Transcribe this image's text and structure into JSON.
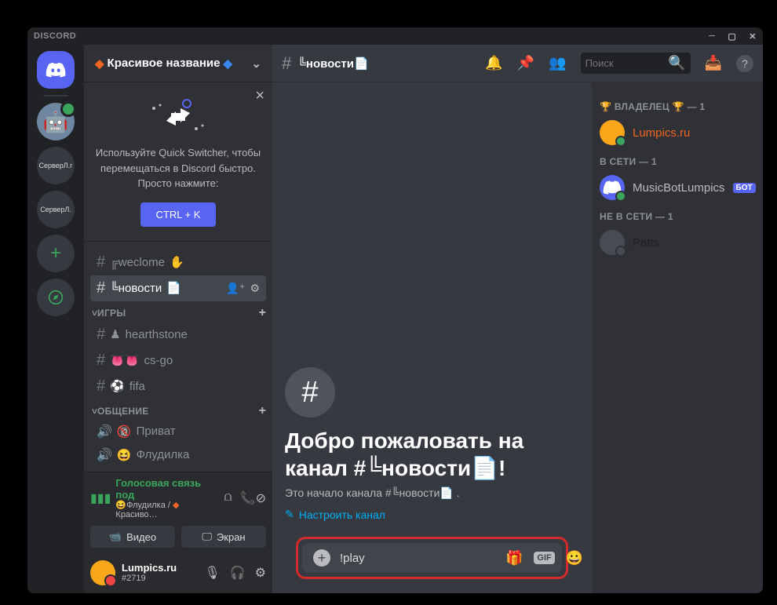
{
  "titlebar": {
    "title": "DISCORD"
  },
  "guilds": {
    "servers": [
      {
        "id": "home",
        "icon": "discord"
      },
      {
        "id": "bot",
        "label": "🤖",
        "robot": true
      },
      {
        "id": "s1",
        "label": "СерверЛ.г"
      },
      {
        "id": "s2",
        "label": "СерверЛ."
      }
    ]
  },
  "server": {
    "name_mid": "Красивое название",
    "qs_text": "Используйте Quick Switcher, чтобы перемещаться в Discord быстро. Просто нажмите:",
    "qs_btn": "CTRL + K"
  },
  "channels": {
    "uncat": [
      {
        "label": "╔weclome",
        "emoji": "✋"
      },
      {
        "label": "╚новости",
        "emoji": "📄",
        "active": true
      }
    ],
    "cat1": {
      "title": "ИГРЫ",
      "items": [
        {
          "label": "hearthstone",
          "prefix": "♟"
        },
        {
          "label": "cs-go",
          "prefix": "👅👅"
        },
        {
          "label": "fifa",
          "prefix": "⚽"
        }
      ]
    },
    "cat2": {
      "title": "ОБЩЕНИЕ",
      "items": [
        {
          "label": "Приват",
          "voice": true,
          "prefix": "🔞"
        },
        {
          "label": "Флудилка",
          "voice": true,
          "prefix": "😆"
        }
      ]
    }
  },
  "voice": {
    "status": "Голосовая связь под",
    "sub1": "Флудилка",
    "sub2": "Красиво…",
    "btn1": "Видео",
    "btn2": "Экран"
  },
  "user": {
    "name": "Lumpics.ru",
    "tag": "#2719"
  },
  "header": {
    "channel": "╚новости",
    "emoji": "📄",
    "search_ph": "Поиск"
  },
  "welcome": {
    "title_line": "Добро пожаловать на канал #╚новости📄!",
    "sub": "Это начало канала #╚новости📄 .",
    "setup": "Настроить канал"
  },
  "composer": {
    "value": "!play"
  },
  "members": {
    "role0": {
      "title": "ВЛАДЕЛЕЦ",
      "count": "— 1"
    },
    "owner": {
      "name": "Lumpics.ru"
    },
    "role1": {
      "title": "В СЕТИ — 1"
    },
    "bot": {
      "name": "MusicBotLumpics",
      "tag": "БОТ"
    },
    "role2": {
      "title": "НЕ В СЕТИ — 1"
    },
    "off": {
      "name": "Patts"
    }
  }
}
